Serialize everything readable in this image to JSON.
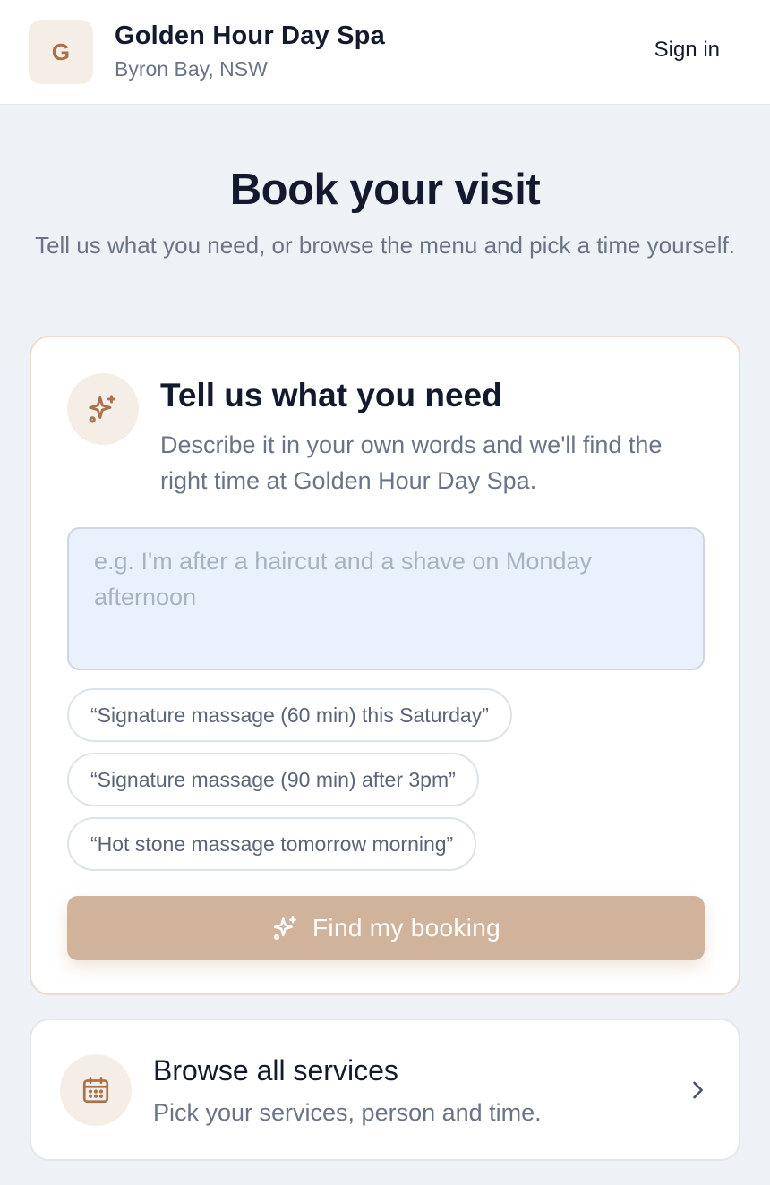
{
  "header": {
    "logo_letter": "G",
    "business_name": "Golden Hour Day Spa",
    "location": "Byron Bay, NSW",
    "sign_in_label": "Sign in"
  },
  "page": {
    "title": "Book your visit",
    "subtitle": "Tell us what you need, or browse the menu and pick a time yourself."
  },
  "request_card": {
    "icon": "sparkles-icon",
    "title": "Tell us what you need",
    "description": "Describe it in your own words and we'll find the right time at Golden Hour Day Spa.",
    "input": {
      "value": "",
      "placeholder": "e.g. I'm after a haircut and a shave on Monday afternoon"
    },
    "suggestions": [
      "“Signature massage (60 min) this Saturday”",
      "“Signature massage (90 min) after 3pm”",
      "“Hot stone massage tomorrow morning”"
    ],
    "submit_label": "Find my booking"
  },
  "browse_card": {
    "icon": "calendar-icon",
    "title": "Browse all services",
    "subtitle": "Pick your services, person and time.",
    "arrow_icon": "chevron-right-icon"
  },
  "colors": {
    "accent": "#a8724a",
    "accent_soft": "#f5eee6",
    "button_disabled": "#d1b39b",
    "background": "#eef2f7",
    "text_primary": "#141a2e",
    "text_muted": "#6a7486"
  }
}
